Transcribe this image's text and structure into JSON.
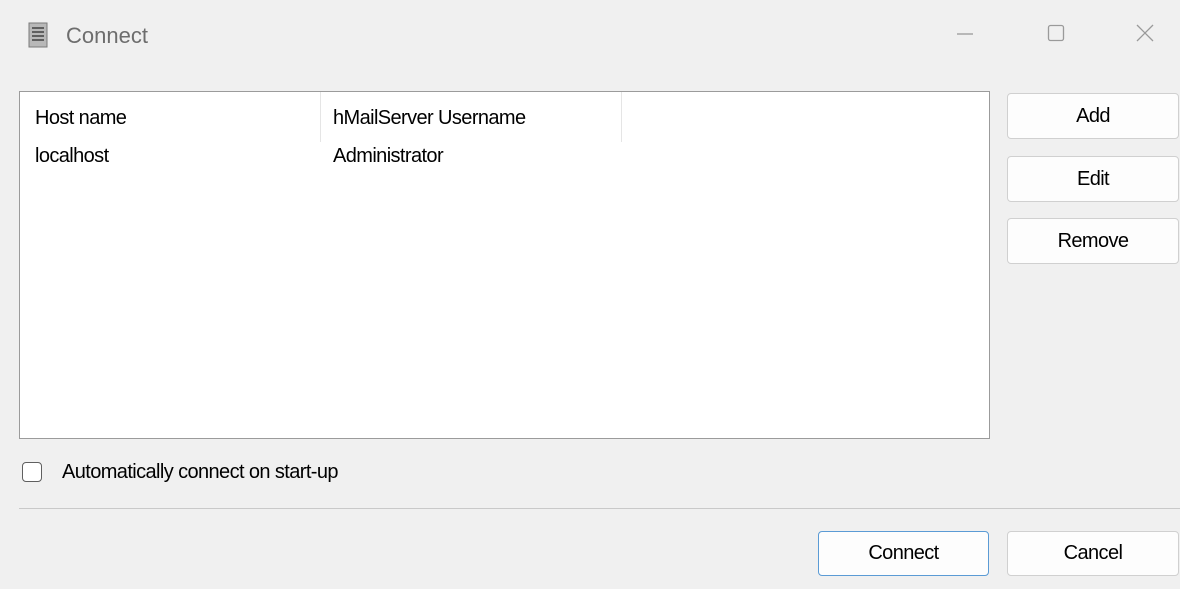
{
  "window": {
    "title": "Connect",
    "icon": "server-document-icon",
    "controls": {
      "minimize_icon": "minimize-icon",
      "maximize_icon": "maximize-icon",
      "close_icon": "close-icon"
    }
  },
  "list": {
    "columns": [
      "Host name",
      "hMailServer Username"
    ],
    "rows": [
      {
        "host": "localhost",
        "username": "Administrator"
      }
    ]
  },
  "side_buttons": {
    "add_label": "Add",
    "edit_label": "Edit",
    "remove_label": "Remove"
  },
  "options": {
    "auto_connect_label": "Automatically connect on start-up",
    "auto_connect_checked": false
  },
  "footer": {
    "connect_label": "Connect",
    "cancel_label": "Cancel"
  },
  "colors": {
    "window_bg": "#f0f0f0",
    "default_button_border": "#5b9bd5",
    "title_text": "#6d6d6d"
  }
}
